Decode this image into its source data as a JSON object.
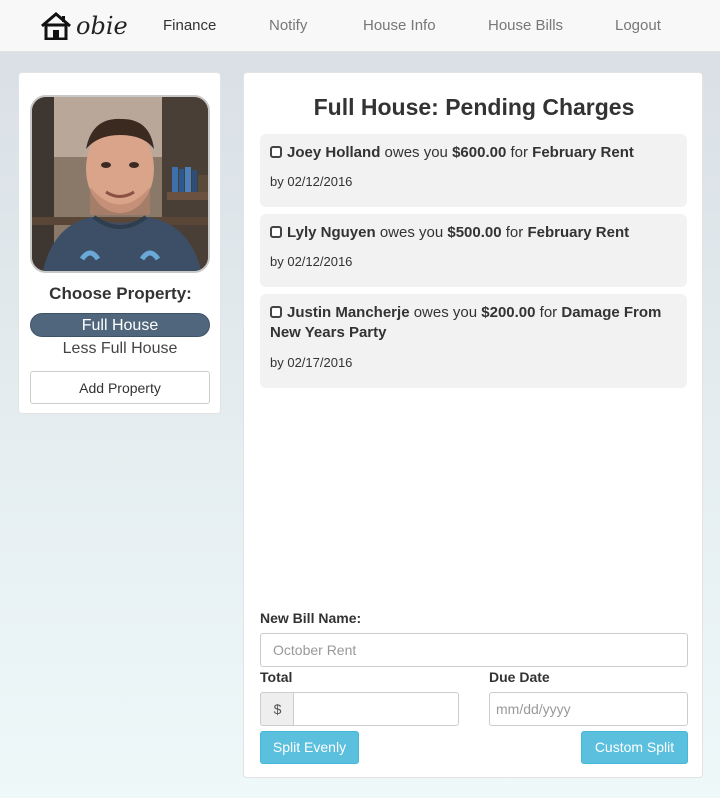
{
  "nav": {
    "brand": "obie",
    "links": [
      "Finance",
      "Notify",
      "House Info",
      "House Bills",
      "Logout"
    ]
  },
  "sidebar": {
    "choose_title": "Choose Property:",
    "properties": [
      "Full House",
      "Less Full House"
    ],
    "selected_property": "Full House",
    "add_property_label": "Add Property"
  },
  "main": {
    "title": "Full House: Pending Charges",
    "charges": [
      {
        "person": "Joey Holland",
        "owes_text": "owes you",
        "amount": "$600.00",
        "for_text": "for",
        "item": "February Rent",
        "due": "by 02/12/2016"
      },
      {
        "person": "Lyly Nguyen",
        "owes_text": "owes you",
        "amount": "$500.00",
        "for_text": "for",
        "item": "February Rent",
        "due": "by 02/12/2016"
      },
      {
        "person": "Justin Mancherje",
        "owes_text": "owes you",
        "amount": "$200.00",
        "for_text": "for",
        "item": "Damage From New Years Party",
        "due": "by 02/17/2016"
      }
    ]
  },
  "form": {
    "bill_name_label": "New Bill Name:",
    "bill_name_placeholder": "October Rent",
    "total_label": "Total",
    "currency_symbol": "$",
    "due_date_label": "Due Date",
    "due_date_placeholder": "mm/dd/yyyy",
    "split_evenly_label": "Split Evenly",
    "custom_split_label": "Custom Split"
  },
  "colors": {
    "accent": "#5bc0de",
    "selected_property": "#50667c",
    "charge_background": "#f2f2f2"
  }
}
